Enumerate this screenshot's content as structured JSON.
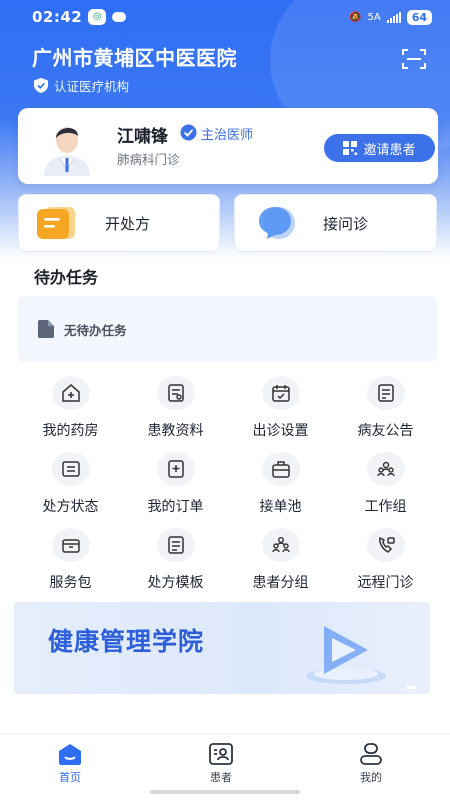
{
  "status_bar": {
    "time": "02:42",
    "battery": "64",
    "network": "5A"
  },
  "header": {
    "hospital_name": "广州市黄埔区中医医院",
    "certified_label": "认证医疗机构"
  },
  "doctor": {
    "name": "江啸锋",
    "title": "主治医师",
    "department": "肺病科门诊",
    "invite_label": "邀请患者"
  },
  "quick_actions": {
    "prescribe": "开处方",
    "consult": "接问诊"
  },
  "todo": {
    "title": "待办任务",
    "empty_text": "无待办任务"
  },
  "grid": [
    {
      "label": "我的药房",
      "icon": "pharmacy-icon"
    },
    {
      "label": "患教资料",
      "icon": "education-icon"
    },
    {
      "label": "出诊设置",
      "icon": "calendar-check-icon"
    },
    {
      "label": "病友公告",
      "icon": "notice-icon"
    },
    {
      "label": "处方状态",
      "icon": "prescription-status-icon"
    },
    {
      "label": "我的订单",
      "icon": "order-icon"
    },
    {
      "label": "接单池",
      "icon": "order-pool-icon"
    },
    {
      "label": "工作组",
      "icon": "workgroup-icon"
    },
    {
      "label": "服务包",
      "icon": "service-package-icon"
    },
    {
      "label": "处方模板",
      "icon": "template-icon"
    },
    {
      "label": "患者分组",
      "icon": "patient-group-icon"
    },
    {
      "label": "远程门诊",
      "icon": "remote-clinic-icon"
    }
  ],
  "banner": {
    "title": "健康管理学院"
  },
  "tabs": [
    {
      "label": "首页",
      "active": true
    },
    {
      "label": "患者",
      "active": false
    },
    {
      "label": "我的",
      "active": false
    }
  ],
  "colors": {
    "primary": "#2f6df4",
    "accent": "#3c71ea",
    "rx_orange": "#f6a623"
  }
}
